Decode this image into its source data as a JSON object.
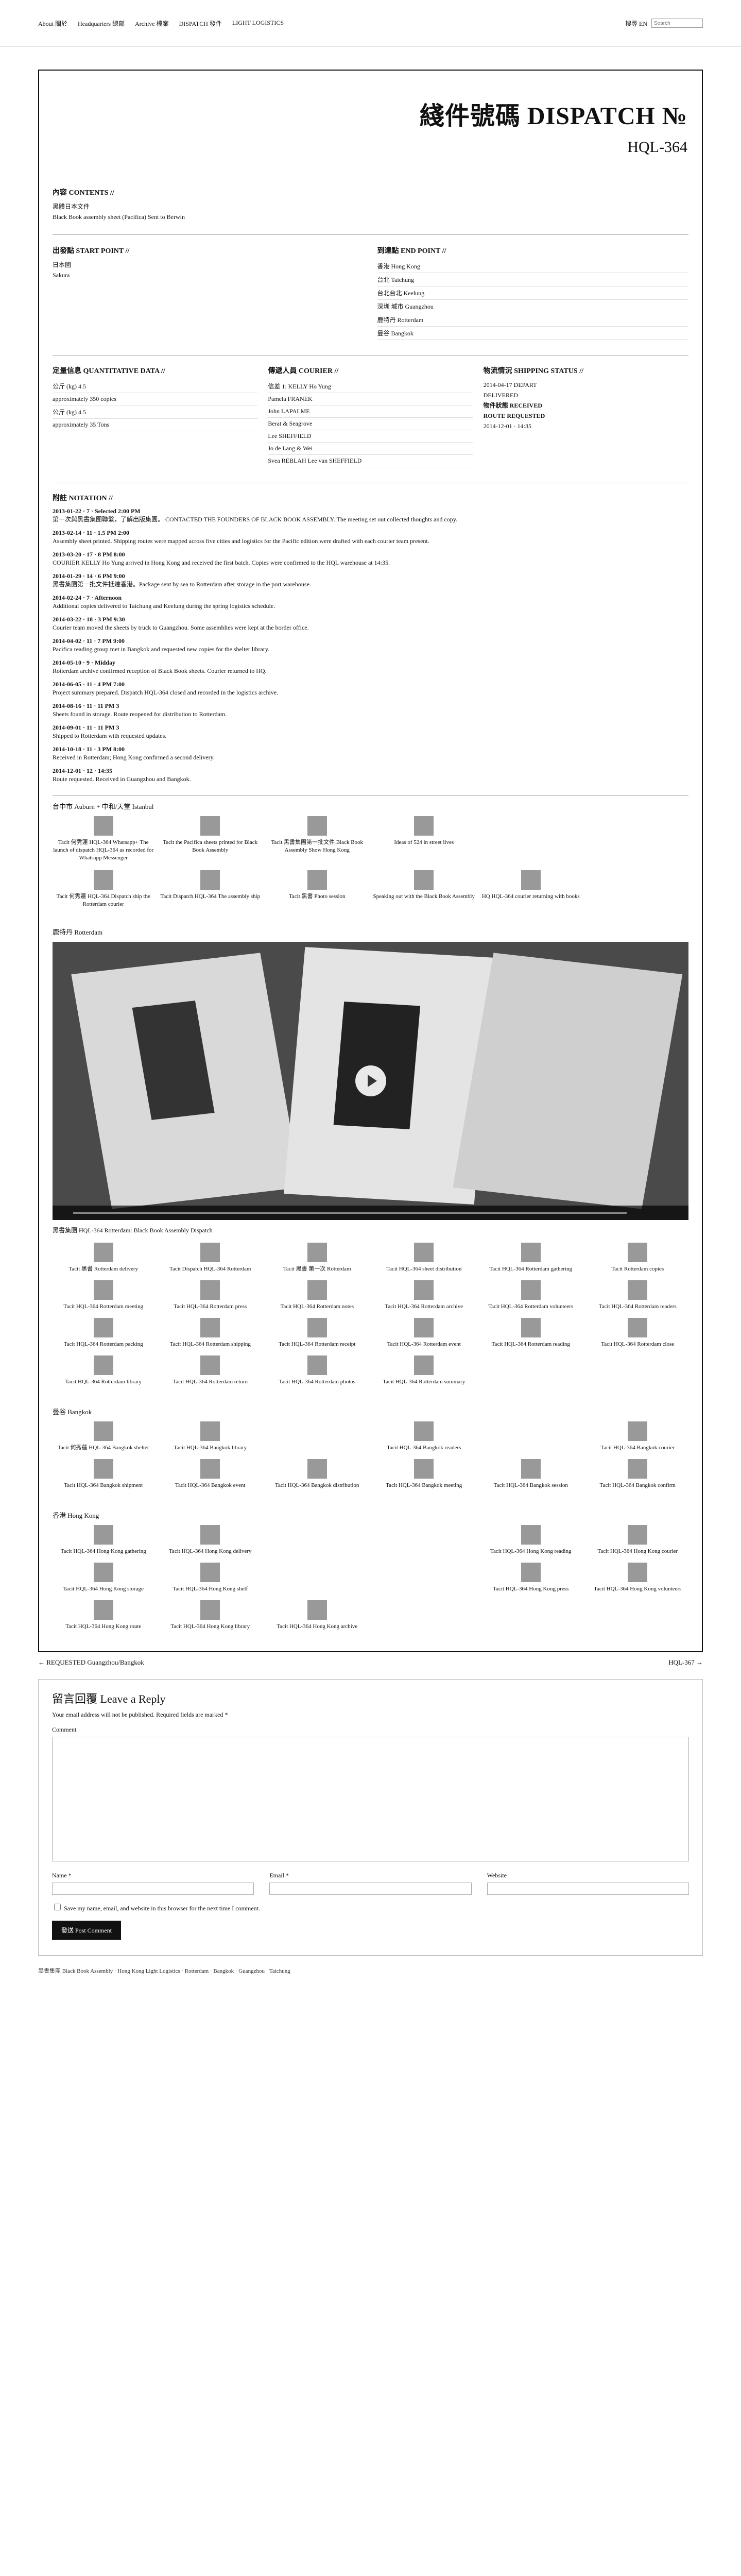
{
  "topbar": {
    "nav": [
      {
        "label": "About 關於",
        "id": "about"
      },
      {
        "label": "Headquarters 總部",
        "id": "hq"
      },
      {
        "label": "Archive 檔案",
        "id": "archive"
      },
      {
        "label": "DISPATCH 發件",
        "id": "dispatch"
      },
      {
        "label": "LIGHT LOGISTICS",
        "id": "light"
      }
    ],
    "lang_label": "搜尋 EN",
    "search_placeholder": "Search"
  },
  "title": {
    "zh": "綫件號碼 DISPATCH №",
    "code": "HQL-364"
  },
  "contents": {
    "header": "內容 CONTENTS //",
    "lines": [
      "黑體日本文件",
      "Black Book assembly sheet (Pacifica) Sent to Berwin"
    ]
  },
  "start_point": {
    "header": "出發點 START POINT //",
    "lines": [
      "日本國",
      "Sakura"
    ]
  },
  "end_point": {
    "header": "到達點 END POINT //",
    "lines": [
      "香港 Hong Kong",
      "台北 Taichung",
      "台北台北 Keelung",
      "深圳 城市 Guangzhou",
      "鹿特丹 Rotterdam",
      "曼谷 Bangkok"
    ]
  },
  "quantitative": {
    "header": "定量信息 QUANTITATIVE DATA //",
    "lines": [
      "公斤 (kg) 4.5",
      "approximately 350 copies",
      "公斤 (kg) 4.5",
      "approximately 35 Tons"
    ]
  },
  "courier": {
    "header": "傳遞人員 COURIER //",
    "lines": [
      "信差 1: KELLY Ho Yung",
      "Pamela FRANEK",
      "John LAPALME",
      "Berat & Seagrove",
      "Lee SHEFFIELD",
      "Jo de Lang & Wei",
      "Svea REBLAH Lee van SHEFFIELD"
    ]
  },
  "shipping": {
    "header": "物流情況 SHIPPING STATUS //",
    "lines": [
      "2014-04-17 DEPART",
      "DELIVERED",
      "",
      "",
      "物件狀態 RECEIVED",
      "ROUTE REQUESTED",
      "2014-12-01 · 14:35"
    ]
  },
  "notation": {
    "header": "附註 NOTATION //",
    "entries": [
      {
        "d": "2013-01-22 · 7 · Selected 2:00 PM",
        "t": "第一次與黑書集團聯繫，了解出版集團。 CONTACTED THE FOUNDERS OF BLACK BOOK ASSEMBLY. The meeting set out collected thoughts and copy."
      },
      {
        "d": "2013-02-14 · 11 · 1.5 PM 2:00",
        "t": "Assembly sheet printed. Shipping routes were mapped across five cities and logistics for the Pacific edition were drafted with each courier team present."
      },
      {
        "d": "2013-03-20 · 17 · 8 PM 8:00",
        "t": "COURIER KELLY Ho Yung arrived in Hong Kong and received the first batch. Copies were confirmed to the HQL warehouse at 14:35."
      },
      {
        "d": "2014-01-29 · 14 · 6 PM 9:00",
        "t": "黑書集團第一批文件抵達香港。Package sent by sea to Rotterdam after storage in the port warehouse."
      },
      {
        "d": "2014-02-24 · 7 · Afternoon",
        "t": "Additional copies delivered to Taichung and Keelung during the spring logistics schedule."
      },
      {
        "d": "2014-03-22 · 18 · 3 PM 9:30",
        "t": "Courier team moved the sheets by truck to Guangzhou. Some assemblies were kept at the border office."
      },
      {
        "d": "2014-04-02 · 11 · 7 PM 9:00",
        "t": "Pacifica reading group met in Bangkok and requested new copies for the shelter library."
      },
      {
        "d": "2014-05-10 · 9 · Midday",
        "t": "Rotterdam archive confirmed reception of Black Book sheets. Courier returned to HQ."
      },
      {
        "d": "2014-06-05 · 11 · 4 PM 7:00",
        "t": "Project summary prepared. Dispatch HQL-364 closed and recorded in the logistics archive."
      },
      {
        "d": "2014-08-16 · 11 · 11 PM 3",
        "t": "Sheets found in storage. Route reopened for distribution to Rotterdam."
      },
      {
        "d": "2014-09-01 · 11 · 11 PM 3",
        "t": "Shipped to Rotterdam with requested updates."
      },
      {
        "d": "2014-10-18 · 11 · 3 PM 8:00",
        "t": "Received in Rotterdam; Hong Kong confirmed a second delivery."
      },
      {
        "d": "2014-12-01 · 12 · 14:35",
        "t": "Route requested. Received in Guangzhou and Bangkok."
      }
    ]
  },
  "galleries": [
    {
      "label": "台中市 Auburn + 中和/天堂 Istanbul",
      "items": [
        "Tacit 何秀蓮 HQL-364 Whatsapp+ The launch of dispatch HQL-364 as recorded for Whatsapp Messenger",
        "Tacit the Pacifica sheets printed for Black Book Assembly",
        "Tacit 黑書集團第一批文件 Black Book Assembly Show Hong Kong",
        "Ideas of 524 in street lives",
        "",
        ""
      ]
    },
    {
      "label": "",
      "items": [
        "Tacit 何秀蓮 HQL-364 Dispatch ship the Rotterdam courier",
        "Tacit Dispatch HQL-364 The assembly ship",
        "Tacit 黑書 Photo session",
        "Speaking out with the Black Book Assembly",
        "HQ HQL-364 courier returning with books",
        ""
      ]
    }
  ],
  "video_section": {
    "label": "鹿特丹 Rotterdam",
    "caption": "黑書集團 HQL-364 Rotterdam: Black Book Assembly Dispatch"
  },
  "rotterdam_items": [
    "Tacit 黑書 Rotterdam delivery",
    "Tacit Dispatch HQL-364 Rotterdam",
    "Tacit 黑書 第一次 Rotterdam",
    "Tacit HQL-364 sheet distribution",
    "Tacit HQL-364 Rotterdam gathering",
    "Tacit Rotterdam copies",
    "Tacit HQL-364 Rotterdam meeting",
    "Tacit HQL-364 Rotterdam press",
    "Tacit HQL-364 Rotterdam notes",
    "Tacit HQL-364 Rotterdam archive",
    "Tacit HQL-364 Rotterdam volunteers",
    "Tacit HQL-364 Rotterdam readers",
    "Tacit HQL-364 Rotterdam packing",
    "Tacit HQL-364 Rotterdam shipping",
    "Tacit HQL-364 Rotterdam receipt",
    "Tacit HQL-364 Rotterdam event",
    "Tacit HQL-364 Rotterdam reading",
    "Tacit HQL-364 Rotterdam close",
    "Tacit HQL-364 Rotterdam library",
    "Tacit HQL-364 Rotterdam return",
    "Tacit HQL-364 Rotterdam photos",
    "Tacit HQL-364 Rotterdam summary",
    "",
    ""
  ],
  "bangkok": {
    "label": "曼谷 Bangkok",
    "items": [
      "Tacit 何秀蓮 HQL-364 Bangkok shelter",
      "Tacit HQL-364 Bangkok library",
      "",
      "Tacit HQL-364 Bangkok readers",
      "",
      "Tacit HQL-364 Bangkok courier",
      "Tacit HQL-364 Bangkok shipment",
      "Tacit HQL-364 Bangkok event",
      "Tacit HQL-364 Bangkok distribution",
      "Tacit HQL-364 Bangkok meeting",
      "Tacit HQL-364 Bangkok session",
      "Tacit HQL-364 Bangkok confirm"
    ]
  },
  "hongkong": {
    "label": "香港 Hong Kong",
    "items": [
      "Tacit HQL-364 Hong Kong gathering",
      "Tacit HQL-364 Hong Kong delivery",
      "",
      "",
      "Tacit HQL-364 Hong Kong reading",
      "Tacit HQL-364 Hong Kong courier",
      "Tacit HQL-364 Hong Kong storage",
      "Tacit HQL-364 Hong Kong shelf",
      "",
      "",
      "Tacit HQL-364 Hong Kong press",
      "Tacit HQL-364 Hong Kong volunteers",
      "Tacit HQL-364 Hong Kong route",
      "Tacit HQL-364 Hong Kong library",
      "Tacit HQL-364 Hong Kong archive"
    ]
  },
  "prevnext": {
    "prev": "← REQUESTED Guangzhou/Bangkok",
    "next": "HQL-367 →"
  },
  "reply": {
    "title": "留言回覆 Leave a Reply",
    "note": "Your email address will not be published. Required fields are marked *",
    "comment_label": "Comment",
    "name_label": "Name *",
    "email_label": "Email *",
    "website_label": "Website",
    "save_label": "Save my name, email, and website in this browser for the next time I comment.",
    "submit": "發送 Post Comment"
  },
  "footer": {
    "text": "黑書集團 Black Book Assembly · Hong Kong Light Logistics · Rotterdam · Bangkok · Guangzhou · Taichung"
  },
  "colors": {
    "ink": "#111111",
    "bg": "#ffffff",
    "rule": "#aaaaaa",
    "thumb": "#999999"
  }
}
